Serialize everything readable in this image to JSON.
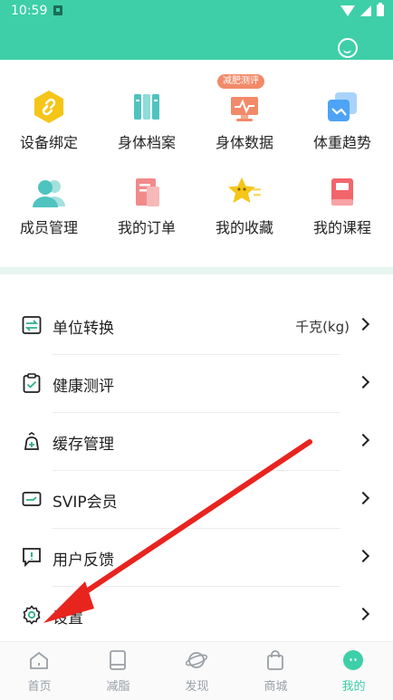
{
  "status_bar": {
    "time": "10:59"
  },
  "header": {
    "chat_icon": "chat-bubble-icon",
    "color": "#3ecfa8"
  },
  "grid": {
    "items": [
      {
        "label": "设备绑定",
        "icon": "link-icon",
        "color": "#f5c518"
      },
      {
        "label": "身体档案",
        "icon": "books-icon",
        "color": "#4fc3c0"
      },
      {
        "label": "身体数据",
        "icon": "monitor-icon",
        "color": "#f28a6a",
        "badge": "减肥测评"
      },
      {
        "label": "体重趋势",
        "icon": "trend-icon",
        "color": "#4da3f5"
      },
      {
        "label": "成员管理",
        "icon": "members-icon",
        "color": "#4fc3c0"
      },
      {
        "label": "我的订单",
        "icon": "order-icon",
        "color": "#f28a8a"
      },
      {
        "label": "我的收藏",
        "icon": "star-icon",
        "color": "#f5c518"
      },
      {
        "label": "我的课程",
        "icon": "course-icon",
        "color": "#f2656b"
      }
    ]
  },
  "menu": {
    "items": [
      {
        "label": "单位转换",
        "value": "千克(kg)",
        "icon": "unit-convert-icon"
      },
      {
        "label": "健康测评",
        "value": "",
        "icon": "clipboard-check-icon"
      },
      {
        "label": "缓存管理",
        "value": "",
        "icon": "cache-bag-icon"
      },
      {
        "label": "SVIP会员",
        "value": "",
        "icon": "vip-card-icon"
      },
      {
        "label": "用户反馈",
        "value": "",
        "icon": "feedback-icon"
      },
      {
        "label": "设置",
        "value": "",
        "icon": "settings-gear-icon"
      }
    ]
  },
  "bottom_nav": {
    "items": [
      {
        "label": "首页",
        "icon": "home-icon",
        "active": false
      },
      {
        "label": "减脂",
        "icon": "book-icon",
        "active": false
      },
      {
        "label": "发现",
        "icon": "planet-icon",
        "active": false
      },
      {
        "label": "商城",
        "icon": "shopping-bag-icon",
        "active": false
      },
      {
        "label": "我的",
        "icon": "profile-face-icon",
        "active": true
      }
    ],
    "active_color": "#3ecfa8"
  },
  "annotation": {
    "arrow_color": "#e8241f"
  }
}
